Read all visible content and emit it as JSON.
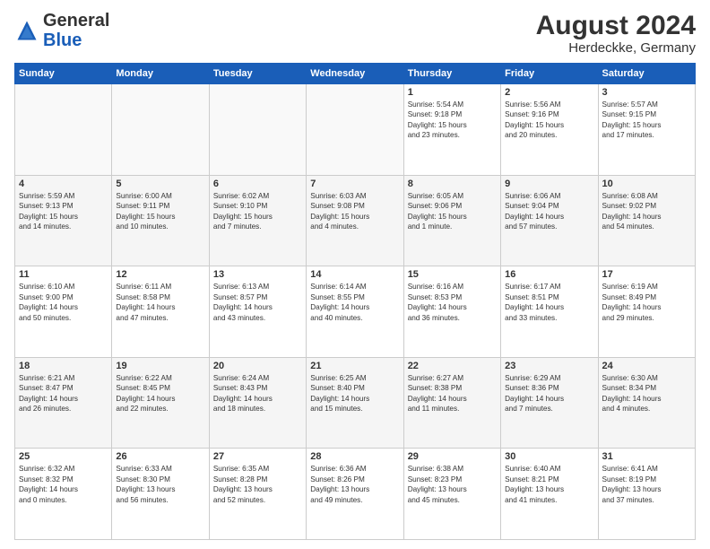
{
  "header": {
    "logo_general": "General",
    "logo_blue": "Blue",
    "month_year": "August 2024",
    "location": "Herdeckke, Germany"
  },
  "weekdays": [
    "Sunday",
    "Monday",
    "Tuesday",
    "Wednesday",
    "Thursday",
    "Friday",
    "Saturday"
  ],
  "weeks": [
    [
      {
        "day": "",
        "info": ""
      },
      {
        "day": "",
        "info": ""
      },
      {
        "day": "",
        "info": ""
      },
      {
        "day": "",
        "info": ""
      },
      {
        "day": "1",
        "info": "Sunrise: 5:54 AM\nSunset: 9:18 PM\nDaylight: 15 hours\nand 23 minutes."
      },
      {
        "day": "2",
        "info": "Sunrise: 5:56 AM\nSunset: 9:16 PM\nDaylight: 15 hours\nand 20 minutes."
      },
      {
        "day": "3",
        "info": "Sunrise: 5:57 AM\nSunset: 9:15 PM\nDaylight: 15 hours\nand 17 minutes."
      }
    ],
    [
      {
        "day": "4",
        "info": "Sunrise: 5:59 AM\nSunset: 9:13 PM\nDaylight: 15 hours\nand 14 minutes."
      },
      {
        "day": "5",
        "info": "Sunrise: 6:00 AM\nSunset: 9:11 PM\nDaylight: 15 hours\nand 10 minutes."
      },
      {
        "day": "6",
        "info": "Sunrise: 6:02 AM\nSunset: 9:10 PM\nDaylight: 15 hours\nand 7 minutes."
      },
      {
        "day": "7",
        "info": "Sunrise: 6:03 AM\nSunset: 9:08 PM\nDaylight: 15 hours\nand 4 minutes."
      },
      {
        "day": "8",
        "info": "Sunrise: 6:05 AM\nSunset: 9:06 PM\nDaylight: 15 hours\nand 1 minute."
      },
      {
        "day": "9",
        "info": "Sunrise: 6:06 AM\nSunset: 9:04 PM\nDaylight: 14 hours\nand 57 minutes."
      },
      {
        "day": "10",
        "info": "Sunrise: 6:08 AM\nSunset: 9:02 PM\nDaylight: 14 hours\nand 54 minutes."
      }
    ],
    [
      {
        "day": "11",
        "info": "Sunrise: 6:10 AM\nSunset: 9:00 PM\nDaylight: 14 hours\nand 50 minutes."
      },
      {
        "day": "12",
        "info": "Sunrise: 6:11 AM\nSunset: 8:58 PM\nDaylight: 14 hours\nand 47 minutes."
      },
      {
        "day": "13",
        "info": "Sunrise: 6:13 AM\nSunset: 8:57 PM\nDaylight: 14 hours\nand 43 minutes."
      },
      {
        "day": "14",
        "info": "Sunrise: 6:14 AM\nSunset: 8:55 PM\nDaylight: 14 hours\nand 40 minutes."
      },
      {
        "day": "15",
        "info": "Sunrise: 6:16 AM\nSunset: 8:53 PM\nDaylight: 14 hours\nand 36 minutes."
      },
      {
        "day": "16",
        "info": "Sunrise: 6:17 AM\nSunset: 8:51 PM\nDaylight: 14 hours\nand 33 minutes."
      },
      {
        "day": "17",
        "info": "Sunrise: 6:19 AM\nSunset: 8:49 PM\nDaylight: 14 hours\nand 29 minutes."
      }
    ],
    [
      {
        "day": "18",
        "info": "Sunrise: 6:21 AM\nSunset: 8:47 PM\nDaylight: 14 hours\nand 26 minutes."
      },
      {
        "day": "19",
        "info": "Sunrise: 6:22 AM\nSunset: 8:45 PM\nDaylight: 14 hours\nand 22 minutes."
      },
      {
        "day": "20",
        "info": "Sunrise: 6:24 AM\nSunset: 8:43 PM\nDaylight: 14 hours\nand 18 minutes."
      },
      {
        "day": "21",
        "info": "Sunrise: 6:25 AM\nSunset: 8:40 PM\nDaylight: 14 hours\nand 15 minutes."
      },
      {
        "day": "22",
        "info": "Sunrise: 6:27 AM\nSunset: 8:38 PM\nDaylight: 14 hours\nand 11 minutes."
      },
      {
        "day": "23",
        "info": "Sunrise: 6:29 AM\nSunset: 8:36 PM\nDaylight: 14 hours\nand 7 minutes."
      },
      {
        "day": "24",
        "info": "Sunrise: 6:30 AM\nSunset: 8:34 PM\nDaylight: 14 hours\nand 4 minutes."
      }
    ],
    [
      {
        "day": "25",
        "info": "Sunrise: 6:32 AM\nSunset: 8:32 PM\nDaylight: 14 hours\nand 0 minutes."
      },
      {
        "day": "26",
        "info": "Sunrise: 6:33 AM\nSunset: 8:30 PM\nDaylight: 13 hours\nand 56 minutes."
      },
      {
        "day": "27",
        "info": "Sunrise: 6:35 AM\nSunset: 8:28 PM\nDaylight: 13 hours\nand 52 minutes."
      },
      {
        "day": "28",
        "info": "Sunrise: 6:36 AM\nSunset: 8:26 PM\nDaylight: 13 hours\nand 49 minutes."
      },
      {
        "day": "29",
        "info": "Sunrise: 6:38 AM\nSunset: 8:23 PM\nDaylight: 13 hours\nand 45 minutes."
      },
      {
        "day": "30",
        "info": "Sunrise: 6:40 AM\nSunset: 8:21 PM\nDaylight: 13 hours\nand 41 minutes."
      },
      {
        "day": "31",
        "info": "Sunrise: 6:41 AM\nSunset: 8:19 PM\nDaylight: 13 hours\nand 37 minutes."
      }
    ]
  ]
}
